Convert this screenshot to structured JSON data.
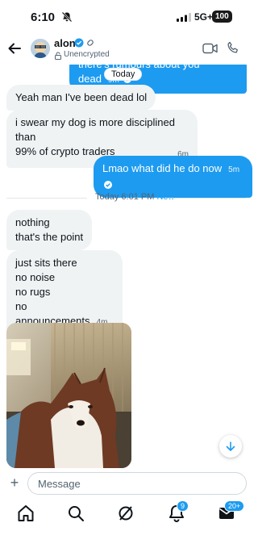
{
  "status": {
    "time": "6:10",
    "network": "5G+",
    "battery": "100"
  },
  "header": {
    "name": "alon",
    "subtitle": "Unencrypted"
  },
  "colors": {
    "accent": "#1d9bf0",
    "incoming_bubble": "#eff3f4"
  },
  "chat": {
    "clipped_message": {
      "text": "there's rumours about you dead",
      "time": "9m"
    },
    "day_label": "Today",
    "messages": [
      {
        "id": "m1",
        "text": "Yeah man I've been dead lol"
      },
      {
        "id": "m2",
        "lines": [
          "i swear my dog is more disciplined than",
          "99% of crypto traders"
        ],
        "time": "6m"
      },
      {
        "id": "m3",
        "text": "Lmao what did he do now",
        "time": "5m"
      }
    ],
    "divider": {
      "label": "Today 6:01 PM",
      "new_label": "New"
    },
    "messages_after": [
      {
        "id": "m4",
        "lines": [
          "nothing",
          "that's the point"
        ]
      },
      {
        "id": "m5",
        "lines": [
          "just sits there",
          "no noise",
          "no rugs",
          "no announcements"
        ],
        "time": "4m"
      }
    ],
    "photo_icon": "husky-dog-photo"
  },
  "composer": {
    "placeholder": "Message"
  },
  "nav": {
    "items": [
      "home-icon",
      "search-icon",
      "grok-icon",
      "notifications-icon",
      "messages-icon"
    ],
    "notifications_badge": "9",
    "messages_badge": "20+"
  }
}
